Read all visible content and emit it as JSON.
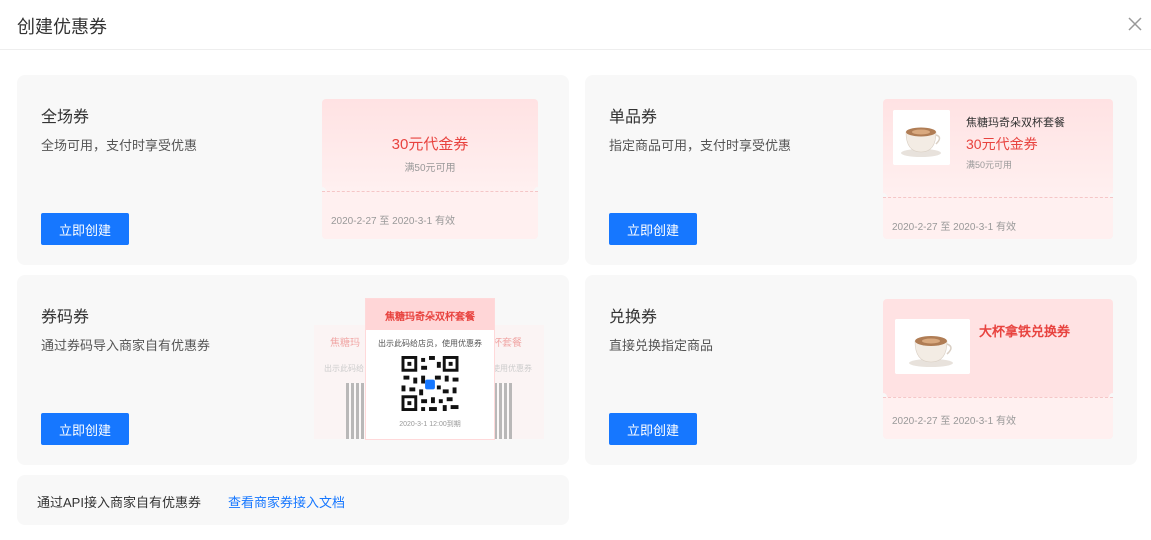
{
  "dialog": {
    "title": "创建优惠券"
  },
  "cards": [
    {
      "title": "全场券",
      "desc": "全场可用，支付时享受优惠",
      "button": "立即创建",
      "coupon": {
        "amount": "30元代金券",
        "condition": "满50元可用",
        "validity": "2020-2-27 至 2020-3-1 有效"
      }
    },
    {
      "title": "单品券",
      "desc": "指定商品可用，支付时享受优惠",
      "button": "立即创建",
      "coupon": {
        "product": "焦糖玛奇朵双杯套餐",
        "amount": "30元代金券",
        "condition": "满50元可用",
        "validity": "2020-2-27 至 2020-3-1 有效"
      }
    },
    {
      "title": "券码券",
      "desc": "通过券码导入商家自有优惠券",
      "button": "立即创建",
      "coupon": {
        "product": "焦糖玛奇朵双杯套餐",
        "side_left": "焦糖玛",
        "side_right": "杯套餐",
        "instruction": "出示此码给店员，使用优惠券",
        "side_instruction_left": "出示此码给",
        "side_instruction_right": "使用优惠券",
        "validity": "2020-3-1 12:00到期"
      }
    },
    {
      "title": "兑换券",
      "desc": "直接兑换指定商品",
      "button": "立即创建",
      "coupon": {
        "product": "大杯拿铁兑换券",
        "validity": "2020-2-27 至 2020-3-1 有效"
      }
    }
  ],
  "api": {
    "text": "通过API接入商家自有优惠券",
    "link": "查看商家券接入文档"
  },
  "icons": {
    "close": "close-icon",
    "product": "coffee-cup-icon",
    "qr": "qr-code-icon"
  },
  "colors": {
    "primary": "#1677ff",
    "accent": "#e8433f",
    "coupon_bg": "#ffe2e3"
  }
}
